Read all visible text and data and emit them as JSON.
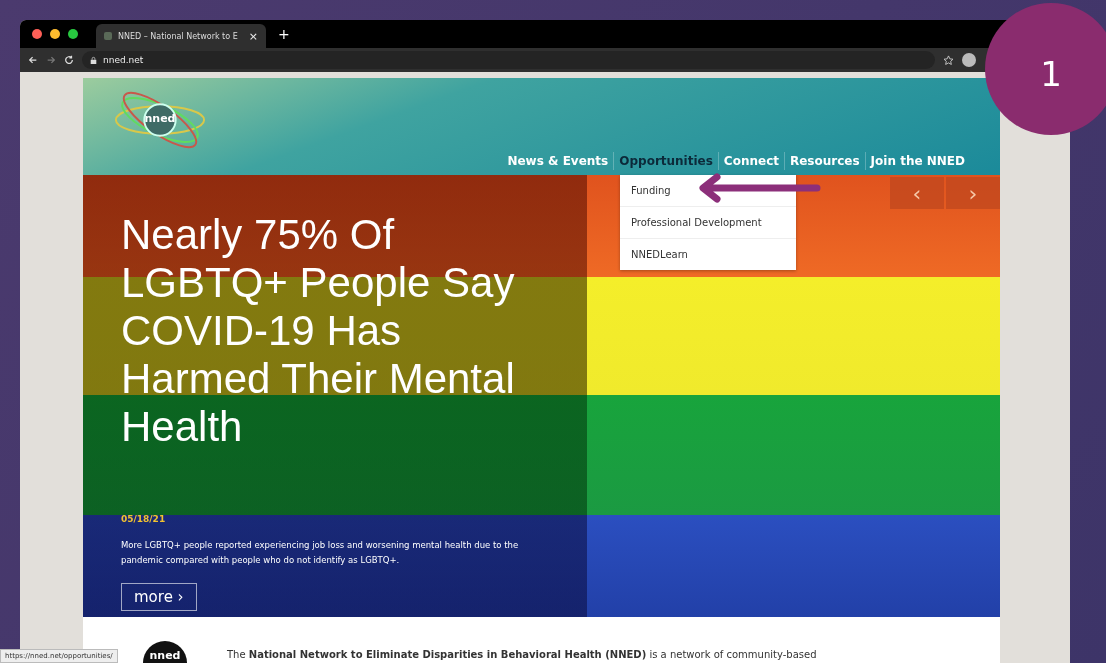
{
  "browser": {
    "tab_title": "NNED – National Network to E",
    "tab_close": "×",
    "new_tab": "+",
    "address": "nned.net"
  },
  "site": {
    "logo_text": "nned",
    "nav": [
      {
        "label": "News & Events",
        "selected": false
      },
      {
        "label": "Opportunities",
        "selected": true
      },
      {
        "label": "Connect",
        "selected": false
      },
      {
        "label": "Resources",
        "selected": false
      },
      {
        "label": "Join the NNED",
        "selected": false
      }
    ],
    "dropdown": [
      {
        "label": "Funding"
      },
      {
        "label": "Professional Development"
      },
      {
        "label": "NNEDLearn"
      }
    ],
    "slider_prev": "‹",
    "slider_next": "›",
    "hero": {
      "title": "Nearly 75% Of LGBTQ+ People Say COVID-19 Has Harmed Their Mental Health",
      "date": "05/18/21",
      "summary": "More LGBTQ+ people reported experiencing job loss and worsening mental health due to the pandemic compared with people who do not identify as LGBTQ+.",
      "more": "more ›"
    },
    "about": {
      "logo_text": "nned",
      "text": "The **National Network to Eliminate Disparities in Behavioral Health (NNED)** is a network of community-based"
    }
  },
  "status_url": "https://nned.net/opportunities/",
  "step_badge": "1"
}
